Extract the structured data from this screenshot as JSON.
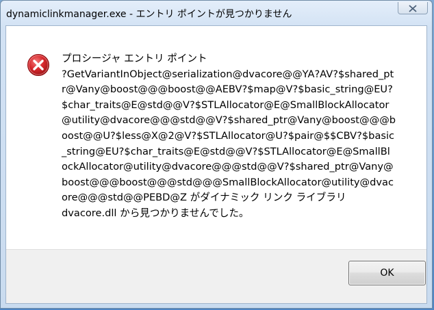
{
  "window": {
    "title": "dynamiclinkmanager.exe - エントリ ポイントが見つかりません"
  },
  "message": {
    "lines": [
      "プロシージャ エントリ ポイント",
      "?GetVariantInObject@serialization@dvacore@@YA?AV?$shared_pt",
      "r@Vany@boost@@@boost@@AEBV?$map@V?$basic_string@EU?",
      "$char_traits@E@std@@V?$STLAllocator@E@SmallBlockAllocator",
      "@utility@dvacore@@@std@@V?$shared_ptr@Vany@boost@@@b",
      "oost@@U?$less@X@2@V?$STLAllocator@U?$pair@$$CBV?$basic",
      "_string@EU?$char_traits@E@std@@V?$STLAllocator@E@SmallBl",
      "ockAllocator@utility@dvacore@@@std@@V?$shared_ptr@Vany@",
      "boost@@@boost@@@std@@@SmallBlockAllocator@utility@dvac",
      "ore@@@std@@PEBD@Z がダイナミック リンク ライブラリ",
      "dvacore.dll から見つかりませんでした。"
    ]
  },
  "buttons": {
    "ok_label": "OK"
  },
  "icons": {
    "error": "error-icon",
    "close": "close-icon"
  },
  "colors": {
    "error_red": "#d7282d",
    "button_bar": "#f0f0f0"
  }
}
